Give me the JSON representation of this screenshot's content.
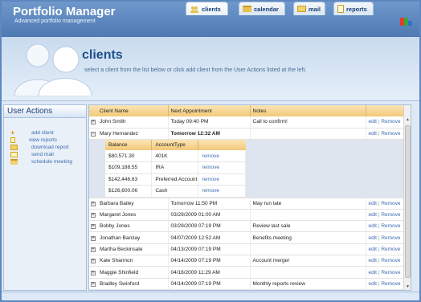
{
  "app": {
    "title": "Portfolio Manager",
    "subtitle": "Advanced portfolio management"
  },
  "tabs": [
    {
      "label": "clients",
      "icon": "people-icon",
      "active": true
    },
    {
      "label": "calendar",
      "icon": "calendar-icon",
      "active": false
    },
    {
      "label": "mail",
      "icon": "mail-icon",
      "active": false
    },
    {
      "label": "reports",
      "icon": "report-icon",
      "active": false
    }
  ],
  "hero": {
    "title": "clients",
    "description": "select a client from the list below or click add client from the User Actions listed at the left."
  },
  "sidebar": {
    "title": "User Actions",
    "actions": [
      {
        "label": "add client",
        "icon": "plus-icon"
      },
      {
        "label": "view reports",
        "icon": "report-icon"
      },
      {
        "label": "download report",
        "icon": "download-icon"
      },
      {
        "label": "send mail",
        "icon": "mail-icon"
      },
      {
        "label": "schedule meeting",
        "icon": "calendar-icon"
      }
    ]
  },
  "grid": {
    "columns": [
      "Client Name",
      "Next Appointment",
      "Notes"
    ],
    "edit_label": "edit",
    "separator": "|",
    "remove_label": "Remove",
    "rows": [
      {
        "name": "John Smith",
        "appointment": "Today 09:40 PM",
        "notes": "Call to confirm!",
        "expanded": false
      },
      {
        "name": "Mary Hernandez",
        "appointment": "Tomorrow 12:32 AM",
        "notes": "",
        "expanded": true
      }
    ],
    "nested": {
      "columns": [
        "Balance",
        "AccountType"
      ],
      "remove_label": "remove",
      "rows": [
        {
          "balance": "$80,571.30",
          "type": "401K"
        },
        {
          "balance": "$109,188.55",
          "type": "IRA"
        },
        {
          "balance": "$142,446.63",
          "type": "Preferred Account"
        },
        {
          "balance": "$126,600.06",
          "type": "Cash"
        }
      ]
    },
    "more_rows": [
      {
        "name": "Barbara Bailey",
        "appointment": "Tomorrow 11:50 PM",
        "notes": "May run late"
      },
      {
        "name": "Margaret Jones",
        "appointment": "03/29/2009 01:00 AM",
        "notes": ""
      },
      {
        "name": "Bobby Jones",
        "appointment": "03/29/2009 07:19 PM",
        "notes": "Review last sale"
      },
      {
        "name": "Jonathan Barclay",
        "appointment": "04/07/2009 12:52 AM",
        "notes": "Benefits meeting"
      },
      {
        "name": "Martha Beckinsale",
        "appointment": "04/13/2009 07:19 PM",
        "notes": ""
      },
      {
        "name": "Kate Shannon",
        "appointment": "04/14/2009 07:19 PM",
        "notes": "Account merger"
      },
      {
        "name": "Maggie Shinfield",
        "appointment": "04/16/2009 11:29 AM",
        "notes": ""
      },
      {
        "name": "Bradley Swinford",
        "appointment": "04/14/2009 07:19 PM",
        "notes": "Monthly reports review"
      }
    ]
  },
  "colors": {
    "accent": "#1f4f8d",
    "header_bg": "#5d87bd",
    "grid_header": "#f3c979",
    "link": "#3d6bb0"
  }
}
